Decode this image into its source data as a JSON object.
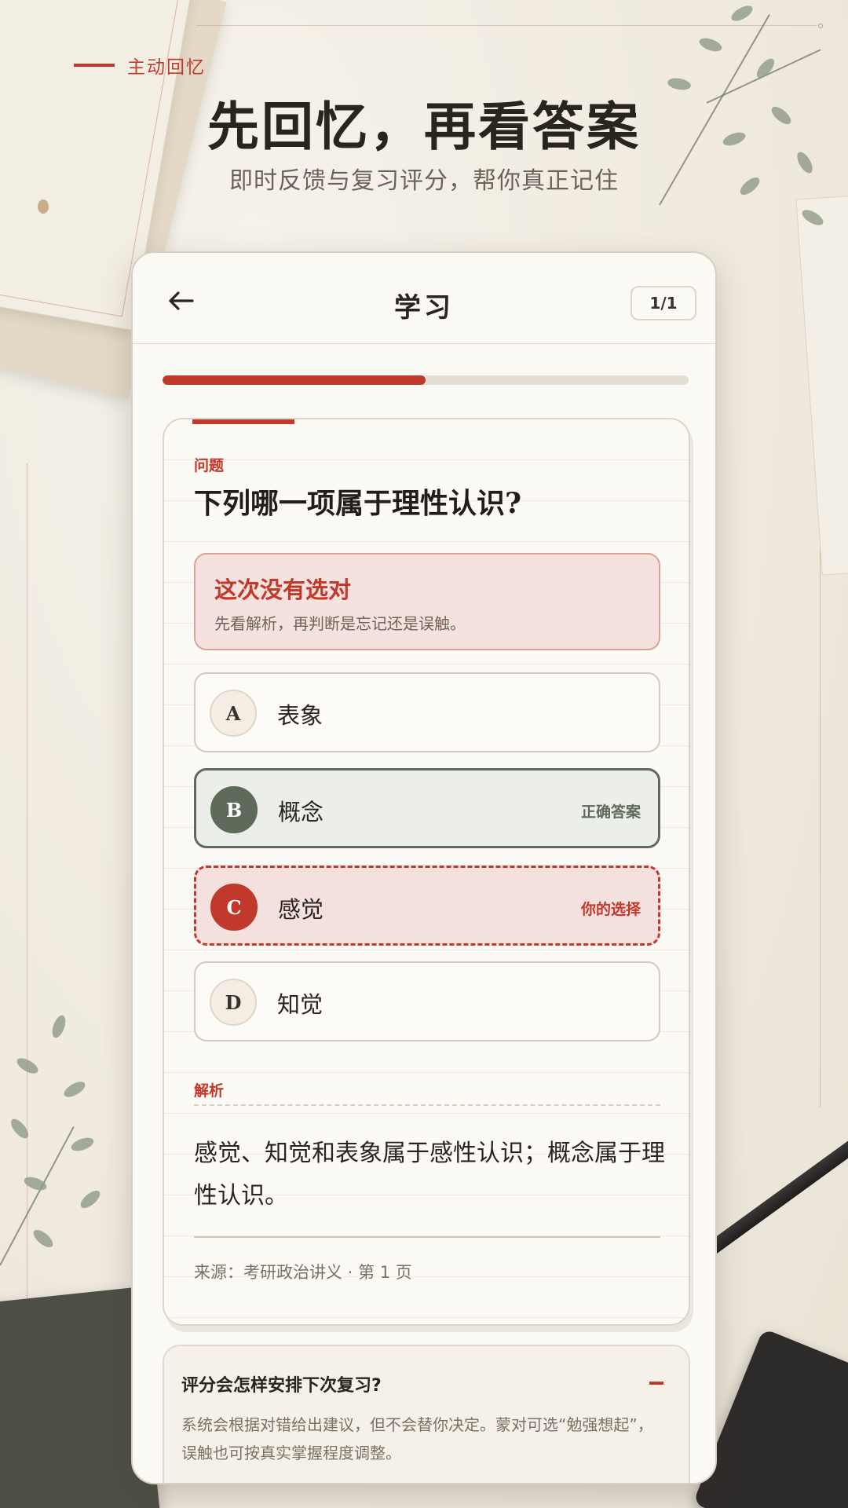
{
  "header": {
    "kicker": "主动回忆",
    "title": "先回忆，再看答案",
    "subtitle": "即时反馈与复习评分，帮你真正记住"
  },
  "appbar": {
    "back_icon": "arrow-left-icon",
    "title": "学习",
    "counter": "1/1"
  },
  "progress": {
    "fraction": 0.5,
    "color": "#c0392b"
  },
  "question": {
    "label": "问题",
    "text": "下列哪一项属于理性认识?"
  },
  "feedback": {
    "title": "这次没有选对",
    "subtitle": "先看解析，再判断是忘记还是误触。"
  },
  "options": [
    {
      "letter": "A",
      "text": "表象",
      "state": "default",
      "tag": ""
    },
    {
      "letter": "B",
      "text": "概念",
      "state": "correct",
      "tag": "正确答案"
    },
    {
      "letter": "C",
      "text": "感觉",
      "state": "wrong",
      "tag": "你的选择"
    },
    {
      "letter": "D",
      "text": "知觉",
      "state": "default",
      "tag": ""
    }
  ],
  "analysis": {
    "label": "解析",
    "text": "感觉、知觉和表象属于感性认识；概念属于理性认识。",
    "source": "来源：考研政治讲义 · 第 1 页"
  },
  "faq": {
    "title": "评分会怎样安排下次复习?",
    "toggle_icon": "minus-icon",
    "body": "系统会根据对错给出建议，但不会替你决定。蒙对可选“勉强想起”，误触也可按真实掌握程度调整。"
  },
  "colors": {
    "accent": "#c0392b",
    "correct": "#5e6a5a",
    "paper": "#fbf9f4"
  }
}
